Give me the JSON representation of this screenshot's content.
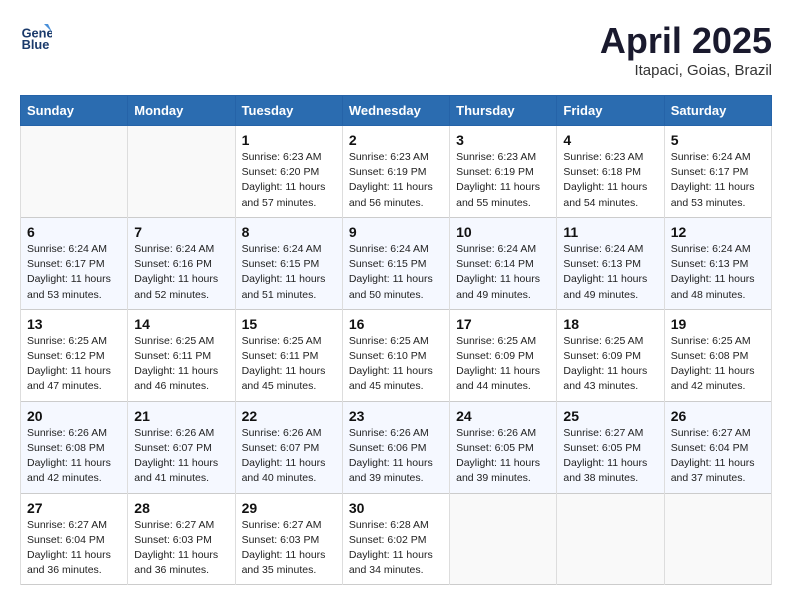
{
  "header": {
    "logo_line1": "General",
    "logo_line2": "Blue",
    "month_title": "April 2025",
    "location": "Itapaci, Goias, Brazil"
  },
  "weekdays": [
    "Sunday",
    "Monday",
    "Tuesday",
    "Wednesday",
    "Thursday",
    "Friday",
    "Saturday"
  ],
  "weeks": [
    [
      {
        "day": "",
        "info": ""
      },
      {
        "day": "",
        "info": ""
      },
      {
        "day": "1",
        "info": "Sunrise: 6:23 AM\nSunset: 6:20 PM\nDaylight: 11 hours and 57 minutes."
      },
      {
        "day": "2",
        "info": "Sunrise: 6:23 AM\nSunset: 6:19 PM\nDaylight: 11 hours and 56 minutes."
      },
      {
        "day": "3",
        "info": "Sunrise: 6:23 AM\nSunset: 6:19 PM\nDaylight: 11 hours and 55 minutes."
      },
      {
        "day": "4",
        "info": "Sunrise: 6:23 AM\nSunset: 6:18 PM\nDaylight: 11 hours and 54 minutes."
      },
      {
        "day": "5",
        "info": "Sunrise: 6:24 AM\nSunset: 6:17 PM\nDaylight: 11 hours and 53 minutes."
      }
    ],
    [
      {
        "day": "6",
        "info": "Sunrise: 6:24 AM\nSunset: 6:17 PM\nDaylight: 11 hours and 53 minutes."
      },
      {
        "day": "7",
        "info": "Sunrise: 6:24 AM\nSunset: 6:16 PM\nDaylight: 11 hours and 52 minutes."
      },
      {
        "day": "8",
        "info": "Sunrise: 6:24 AM\nSunset: 6:15 PM\nDaylight: 11 hours and 51 minutes."
      },
      {
        "day": "9",
        "info": "Sunrise: 6:24 AM\nSunset: 6:15 PM\nDaylight: 11 hours and 50 minutes."
      },
      {
        "day": "10",
        "info": "Sunrise: 6:24 AM\nSunset: 6:14 PM\nDaylight: 11 hours and 49 minutes."
      },
      {
        "day": "11",
        "info": "Sunrise: 6:24 AM\nSunset: 6:13 PM\nDaylight: 11 hours and 49 minutes."
      },
      {
        "day": "12",
        "info": "Sunrise: 6:24 AM\nSunset: 6:13 PM\nDaylight: 11 hours and 48 minutes."
      }
    ],
    [
      {
        "day": "13",
        "info": "Sunrise: 6:25 AM\nSunset: 6:12 PM\nDaylight: 11 hours and 47 minutes."
      },
      {
        "day": "14",
        "info": "Sunrise: 6:25 AM\nSunset: 6:11 PM\nDaylight: 11 hours and 46 minutes."
      },
      {
        "day": "15",
        "info": "Sunrise: 6:25 AM\nSunset: 6:11 PM\nDaylight: 11 hours and 45 minutes."
      },
      {
        "day": "16",
        "info": "Sunrise: 6:25 AM\nSunset: 6:10 PM\nDaylight: 11 hours and 45 minutes."
      },
      {
        "day": "17",
        "info": "Sunrise: 6:25 AM\nSunset: 6:09 PM\nDaylight: 11 hours and 44 minutes."
      },
      {
        "day": "18",
        "info": "Sunrise: 6:25 AM\nSunset: 6:09 PM\nDaylight: 11 hours and 43 minutes."
      },
      {
        "day": "19",
        "info": "Sunrise: 6:25 AM\nSunset: 6:08 PM\nDaylight: 11 hours and 42 minutes."
      }
    ],
    [
      {
        "day": "20",
        "info": "Sunrise: 6:26 AM\nSunset: 6:08 PM\nDaylight: 11 hours and 42 minutes."
      },
      {
        "day": "21",
        "info": "Sunrise: 6:26 AM\nSunset: 6:07 PM\nDaylight: 11 hours and 41 minutes."
      },
      {
        "day": "22",
        "info": "Sunrise: 6:26 AM\nSunset: 6:07 PM\nDaylight: 11 hours and 40 minutes."
      },
      {
        "day": "23",
        "info": "Sunrise: 6:26 AM\nSunset: 6:06 PM\nDaylight: 11 hours and 39 minutes."
      },
      {
        "day": "24",
        "info": "Sunrise: 6:26 AM\nSunset: 6:05 PM\nDaylight: 11 hours and 39 minutes."
      },
      {
        "day": "25",
        "info": "Sunrise: 6:27 AM\nSunset: 6:05 PM\nDaylight: 11 hours and 38 minutes."
      },
      {
        "day": "26",
        "info": "Sunrise: 6:27 AM\nSunset: 6:04 PM\nDaylight: 11 hours and 37 minutes."
      }
    ],
    [
      {
        "day": "27",
        "info": "Sunrise: 6:27 AM\nSunset: 6:04 PM\nDaylight: 11 hours and 36 minutes."
      },
      {
        "day": "28",
        "info": "Sunrise: 6:27 AM\nSunset: 6:03 PM\nDaylight: 11 hours and 36 minutes."
      },
      {
        "day": "29",
        "info": "Sunrise: 6:27 AM\nSunset: 6:03 PM\nDaylight: 11 hours and 35 minutes."
      },
      {
        "day": "30",
        "info": "Sunrise: 6:28 AM\nSunset: 6:02 PM\nDaylight: 11 hours and 34 minutes."
      },
      {
        "day": "",
        "info": ""
      },
      {
        "day": "",
        "info": ""
      },
      {
        "day": "",
        "info": ""
      }
    ]
  ]
}
